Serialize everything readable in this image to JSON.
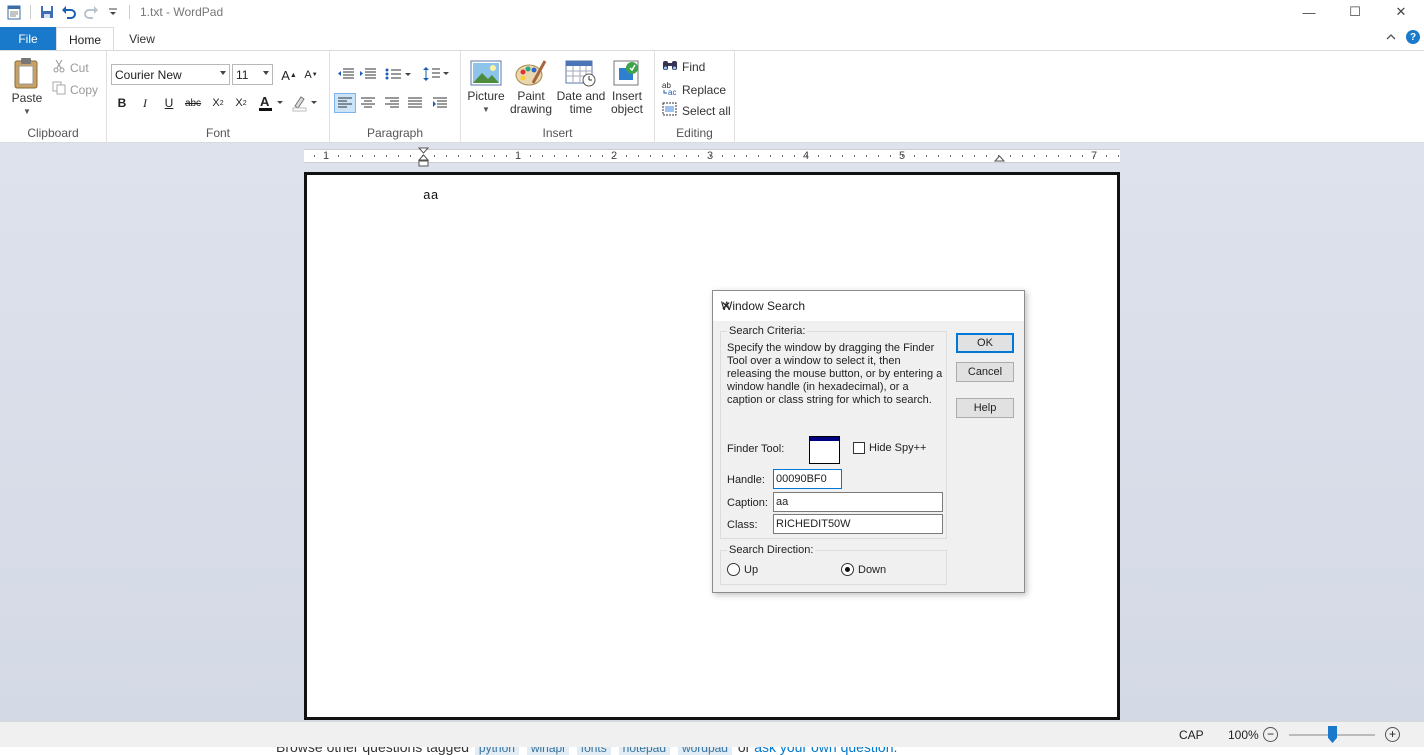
{
  "window": {
    "title": "1.txt - WordPad",
    "minimize_glyph": "—",
    "maximize_glyph": "☐",
    "close_glyph": "✕"
  },
  "tabs": {
    "file": "File",
    "home": "Home",
    "view": "View"
  },
  "ribbon": {
    "clipboard": {
      "paste": "Paste",
      "cut": "Cut",
      "copy": "Copy",
      "group": "Clipboard"
    },
    "font": {
      "family": "Courier New",
      "size": "11",
      "group": "Font"
    },
    "paragraph": {
      "group": "Paragraph"
    },
    "insert": {
      "picture": "Picture",
      "paint_line1": "Paint",
      "paint_line2": "drawing",
      "date_line1": "Date and",
      "date_line2": "time",
      "object_line1": "Insert",
      "object_line2": "object",
      "group": "Insert"
    },
    "editing": {
      "find": "Find",
      "replace": "Replace",
      "select_all": "Select all",
      "group": "Editing"
    }
  },
  "ruler": {
    "numbers": [
      "1",
      "1",
      "2",
      "3",
      "4",
      "5",
      "7"
    ]
  },
  "document": {
    "text": "aa"
  },
  "status": {
    "cap": "CAP",
    "zoom": "100%",
    "zoom_level_fraction": 0.5
  },
  "background_page": {
    "text": "Browse other questions tagged",
    "tags": [
      "python",
      "winapi",
      "fonts",
      "notepad",
      "wordpad"
    ],
    "or": "or",
    "link": "ask your own question."
  },
  "dialog": {
    "title": "Window Search",
    "criteria_legend": "Search Criteria:",
    "description": "Specify the window by dragging the Finder Tool over a window to select it, then releasing the mouse button, or by entering a window handle (in hexadecimal), or a caption or class string for which to search.",
    "finder_label": "Finder Tool:",
    "hide_spy": "Hide Spy++",
    "hide_spy_checked": false,
    "handle_label": "Handle:",
    "handle_value": "00090BF0",
    "caption_label": "Caption:",
    "caption_value": "aa",
    "class_label": "Class:",
    "class_value": "RICHEDIT50W",
    "direction_legend": "Search Direction:",
    "up": "Up",
    "down": "Down",
    "direction_selected": "Down",
    "ok": "OK",
    "cancel": "Cancel",
    "help": "Help"
  }
}
